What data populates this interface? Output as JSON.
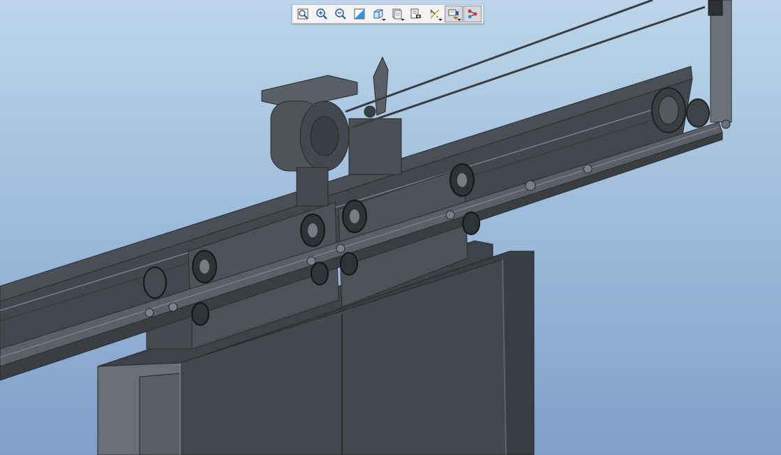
{
  "toolbar": {
    "buttons": [
      {
        "icon": "refit-icon",
        "active": false
      },
      {
        "icon": "zoom-in-icon",
        "active": false
      },
      {
        "icon": "zoom-out-icon",
        "active": false
      },
      {
        "icon": "repaint-icon",
        "active": false
      },
      {
        "icon": "saved-orientations-icon",
        "active": false
      },
      {
        "icon": "layers-icon",
        "active": false
      },
      {
        "icon": "view-manager-icon",
        "active": false
      },
      {
        "icon": "datum-display-icon",
        "active": false
      },
      {
        "icon": "annotation-display-icon",
        "active": true
      },
      {
        "icon": "spin-center-icon",
        "active": true
      }
    ]
  },
  "colors": {
    "background_top": "#bcd5ea",
    "background_bottom": "#7f9fc8",
    "model_dark": "#3b3e44",
    "model_mid": "#4a4e55",
    "model_light": "#6a6f77"
  }
}
